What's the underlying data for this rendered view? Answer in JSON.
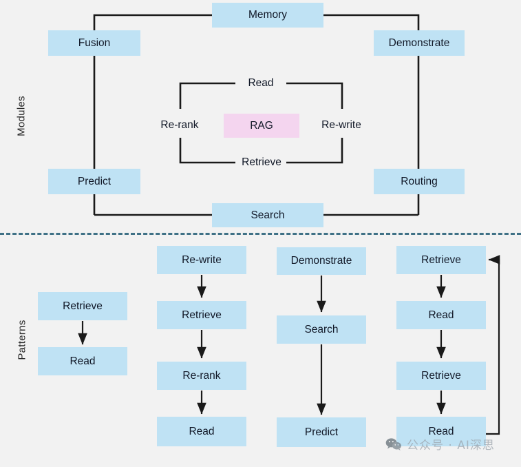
{
  "sections": {
    "modules_label": "Modules",
    "patterns_label": "Patterns"
  },
  "modules": {
    "center": {
      "label": "RAG",
      "color": "#f4d5ef"
    },
    "box_color": "#bfe2f4",
    "line_color": "#1a1a1a",
    "background": "#f2f2f2",
    "outer_ring": [
      {
        "id": "memory",
        "label": "Memory"
      },
      {
        "id": "demonstrate",
        "label": "Demonstrate"
      },
      {
        "id": "routing",
        "label": "Routing"
      },
      {
        "id": "search",
        "label": "Search"
      },
      {
        "id": "predict",
        "label": "Predict"
      },
      {
        "id": "fusion",
        "label": "Fusion"
      }
    ],
    "inner_ring": [
      {
        "id": "read",
        "label": "Read"
      },
      {
        "id": "re-write",
        "label": "Re-write"
      },
      {
        "id": "retrieve",
        "label": "Retrieve"
      },
      {
        "id": "re-rank",
        "label": "Re-rank"
      }
    ]
  },
  "patterns": {
    "columns": [
      {
        "id": "pattern-1",
        "steps": [
          "Retrieve",
          "Read"
        ]
      },
      {
        "id": "pattern-2",
        "steps": [
          "Re-write",
          "Retrieve",
          "Re-rank",
          "Read"
        ]
      },
      {
        "id": "pattern-3",
        "steps": [
          "Demonstrate",
          "Search",
          "Predict"
        ]
      },
      {
        "id": "pattern-4",
        "steps": [
          "Retrieve",
          "Read",
          "Retrieve",
          "Read"
        ],
        "loop_back": true
      }
    ]
  },
  "watermark": {
    "icon": "wechat-icon",
    "text": "公众号 · AI深思"
  }
}
